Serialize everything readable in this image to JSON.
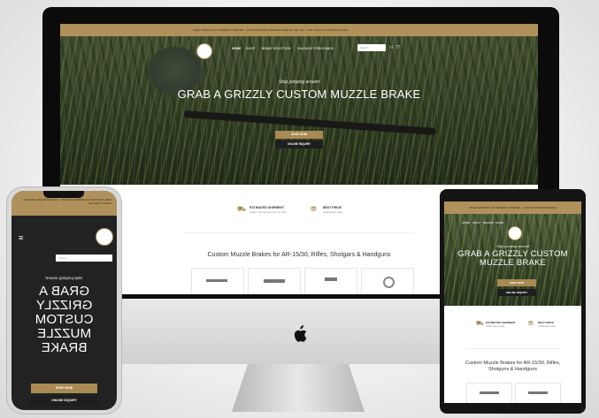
{
  "imac": {
    "announcement": "FREE SHIPPING ON ORDERS OVER $99 · CUSTOM MUZZLE BRAKES MADE IN THE USA · CALL US FOR CUSTOM QUOTES",
    "nav": [
      "HOME",
      "SHOP",
      "BRAKE SELECTION",
      "SAUSAGE FORKS MADE"
    ],
    "search_placeholder": "Search",
    "hero_eyebrow": "Stop jumping around",
    "hero_title": "GRAB A GRIZZLY CUSTOM MUZZLE BRAKE",
    "shop_button": "SHOP NOW",
    "dark_button": "ONLINE INQUIRY",
    "features": [
      {
        "title": "ESTIMATED SHIPMENT",
        "sub": "Orders ship quickly from our shop",
        "icon": "truck-icon"
      },
      {
        "title": "BEST PRICE",
        "sub": "Guaranteed value"
      }
    ],
    "section_heading": "Custom Muzzle Brakes for AR-15/30, Rifles, Shotgars & Handguns",
    "categories": [
      {
        "name": "rifle",
        "icon": "rifle-icon"
      },
      {
        "name": "ar",
        "icon": "ar-rifle-icon"
      },
      {
        "name": "handgun",
        "icon": "handgun-icon"
      },
      {
        "name": "brake",
        "icon": "brake-icon"
      }
    ],
    "apple_logo": ""
  },
  "phone": {
    "announcement": "FREE SHIPPING ON ORDERS OVER $99 · CUSTOM MUZZLE BRAKES MADE IN THE USA",
    "search_placeholder": "Search",
    "hero_eyebrow": "Stop jumping around",
    "hero_title_lines": [
      "GRAB A",
      "GRIZZLY",
      "CUSTOM",
      "MUZZLE",
      "BRAKE"
    ],
    "shop_button": "SHOP NOW",
    "dark_button": "ONLINE INQUIRY"
  },
  "tablet": {
    "announcement": "FREE SHIPPING ON ORDERS OVER $99 · CUSTOM MUZZLE BRAKES",
    "nav": [
      "HOME",
      "SHOP",
      "BRAKES",
      "MORE"
    ],
    "hero_eyebrow": "Stop jumping around",
    "hero_title_lines": [
      "GRAB A GRIZZLY CUSTOM",
      "MUZZLE BRAKE"
    ],
    "shop_button": "SHOP NOW",
    "dark_button": "ONLINE INQUIRY",
    "features": [
      {
        "title": "ESTIMATED SHIPMENT",
        "sub": "Orders ship quickly"
      },
      {
        "title": "BEST PRICE",
        "sub": "Guaranteed value"
      }
    ],
    "section_heading": "Custom Muzzle Brakes for AR-15/30, Rifles, Shotguns & Handguns"
  },
  "colors": {
    "accent_gold": "#b0915b",
    "button_dark": "#1e1e1e"
  }
}
